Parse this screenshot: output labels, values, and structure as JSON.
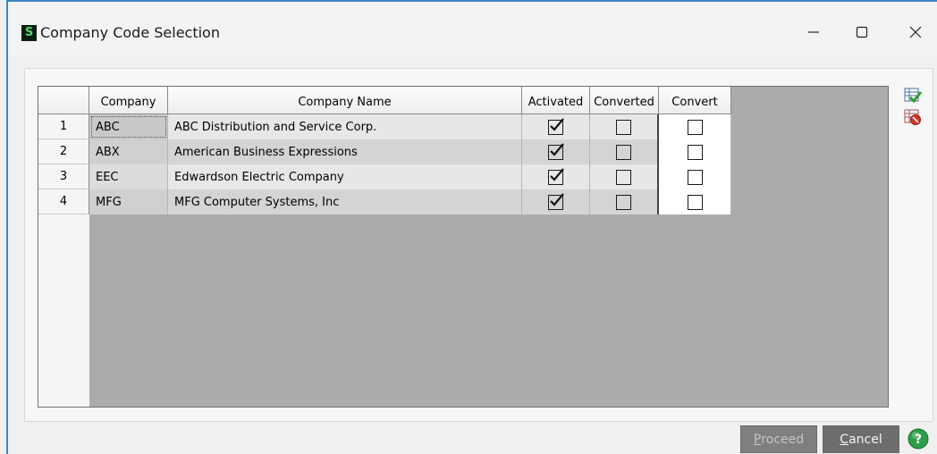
{
  "window": {
    "app_icon_letter": "S",
    "title": "Company Code Selection",
    "controls": {
      "minimize": "—",
      "maximize": "☐",
      "close": "✕"
    }
  },
  "grid": {
    "columns": [
      "Company",
      "Company Name",
      "Activated",
      "Converted",
      "Convert"
    ],
    "rows": [
      {
        "num": "1",
        "company": "ABC",
        "name": "ABC Distribution and Service Corp.",
        "activated": true,
        "converted": false,
        "convert": false
      },
      {
        "num": "2",
        "company": "ABX",
        "name": "American Business Expressions",
        "activated": true,
        "converted": false,
        "convert": false
      },
      {
        "num": "3",
        "company": "EEC",
        "name": "Edwardson Electric Company",
        "activated": true,
        "converted": false,
        "convert": false
      },
      {
        "num": "4",
        "company": "MFG",
        "name": "MFG Computer Systems, Inc",
        "activated": true,
        "converted": false,
        "convert": false
      }
    ]
  },
  "side_icons": [
    "select-all-icon",
    "clear-all-icon"
  ],
  "buttons": {
    "proceed_hotkey": "P",
    "proceed_rest": "roceed",
    "cancel_hotkey": "C",
    "cancel_rest": "ancel"
  },
  "colors": {
    "title_accent": "#3a86c8",
    "button_bg": "#7f7f7f",
    "help_green": "#2e9e4a"
  }
}
